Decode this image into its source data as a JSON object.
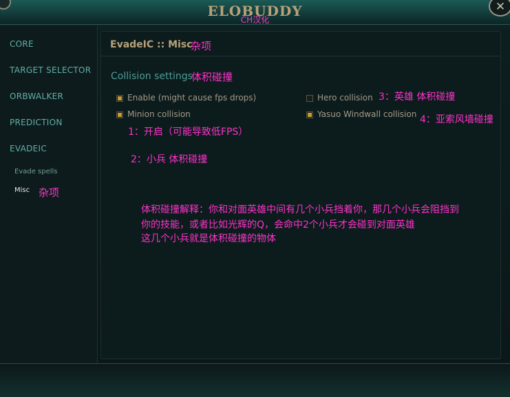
{
  "window": {
    "title": "ELOBUDDY",
    "subtitle_note": "CH汉化",
    "close_glyph": "✕"
  },
  "sidebar": {
    "items": [
      {
        "label": "CORE"
      },
      {
        "label": "TARGET SELECTOR"
      },
      {
        "label": "ORBWALKER"
      },
      {
        "label": "PREDICTION"
      },
      {
        "label": "EVADEIC"
      }
    ],
    "sub_items": [
      {
        "label": "Evade spells",
        "active": false
      },
      {
        "label": "Misc",
        "active": true
      }
    ],
    "misc_note": "杂项"
  },
  "content": {
    "header": {
      "title": "EvadeIC :: Misc",
      "note": "杂项"
    },
    "section": {
      "title": "Collision settings",
      "note": "体积碰撞"
    },
    "options": [
      {
        "label": "Enable (might cause fps drops)",
        "checked": true,
        "note": "1：开启（可能导致低FPS）"
      },
      {
        "label": "Minion collision",
        "checked": true,
        "note": "2：小兵 体积碰撞"
      },
      {
        "label": "Hero collision",
        "checked": false,
        "note": "3：英雄 体积碰撞"
      },
      {
        "label": "Yasuo Windwall collision",
        "checked": true,
        "note": "4：亚索风墙碰撞"
      }
    ],
    "explanation": [
      "体积碰撞解释：你和对面英雄中间有几个小兵挡着你，那几个小兵会阻挡到",
      "你的技能，或者比如光辉的Q，会命中2个小兵才会碰到对面英雄",
      "这几个小兵就是体积碰撞的物体"
    ]
  },
  "colors": {
    "accent_gold": "#b8a27a",
    "nav_teal": "#5fb0aa",
    "annotation_pink": "#ff33cc",
    "checkbox_fill": "#c89a2e"
  }
}
